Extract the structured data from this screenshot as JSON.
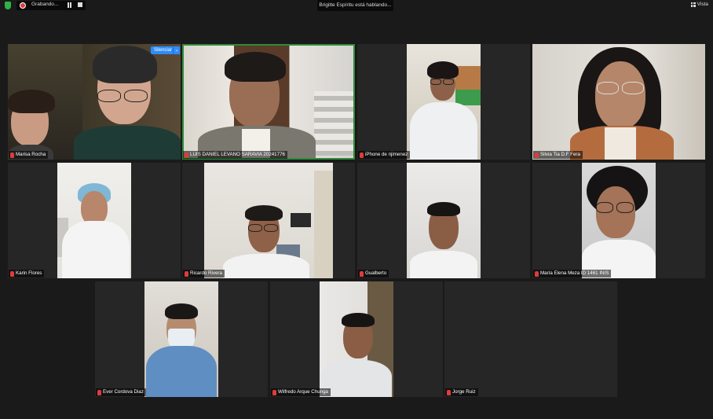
{
  "topbar": {
    "recording_label": "Grabando...",
    "speaking_label": "Brigitte Espíritu está hablando...",
    "view_label": "Vista"
  },
  "mute_menu": {
    "button_label": "Silenciar",
    "caret": "⌄"
  },
  "participants": [
    {
      "name": "Marisa Rocha",
      "muted": true
    },
    {
      "name": "LUIS DANIEL LEVANO SARAVIA 20241776",
      "muted": true
    },
    {
      "name": "iPhone de njimenez",
      "muted": true
    },
    {
      "name": "Silvia Tia D.F Fera",
      "muted": true
    },
    {
      "name": "Karin Flores",
      "muted": true
    },
    {
      "name": "Ricardo Rivera",
      "muted": true
    },
    {
      "name": "Gualberto",
      "muted": true
    },
    {
      "name": "María Elena Meza ID 1461 INIS",
      "muted": true
    },
    {
      "name": "Ever Cordova Diaz",
      "muted": true
    },
    {
      "name": "Wilfredo Arque Chunga",
      "muted": true
    },
    {
      "name": "Jorge Ruiz",
      "muted": true
    }
  ]
}
